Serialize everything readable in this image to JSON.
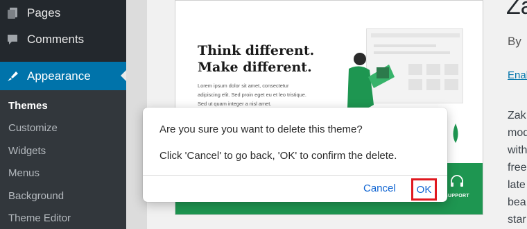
{
  "sidebar": {
    "items": [
      {
        "label": "Pages",
        "icon": "pages-icon"
      },
      {
        "label": "Comments",
        "icon": "comments-icon"
      },
      {
        "label": "Appearance",
        "icon": "appearance-brush-icon"
      }
    ],
    "submenu": [
      "Themes",
      "Customize",
      "Widgets",
      "Menus",
      "Background",
      "Theme Editor"
    ],
    "current": "Themes"
  },
  "preview": {
    "headline_1": "Think different.",
    "headline_2": "Make different.",
    "body_1": "Lorem ipsum dolor sit amet, consectetur",
    "body_2": "adipiscing elit. Sed proin eget eu et leo tristique.",
    "body_3": "Sed ut quam integer a nisl amet.",
    "support_label": "SUPPORT",
    "support_icon": "headset-icon"
  },
  "theme_details": {
    "title_fragment": "Za",
    "by_fragment": "By",
    "enable_fragment": "Enab",
    "description_fragments": [
      "Zak",
      "mod",
      "with",
      "free",
      "late",
      "bea",
      "star"
    ]
  },
  "dialog": {
    "question": "Are you sure you want to delete this theme?",
    "info": "Click 'Cancel' to go back, 'OK' to confirm the delete.",
    "cancel_label": "Cancel",
    "ok_label": "OK"
  },
  "colors": {
    "sidebar_bg": "#23282d",
    "submenu_bg": "#32373c",
    "active_menu": "#0073aa",
    "preview_green": "#1e9651",
    "dialog_button": "#0f64d2",
    "highlight_border": "#e0181f"
  }
}
